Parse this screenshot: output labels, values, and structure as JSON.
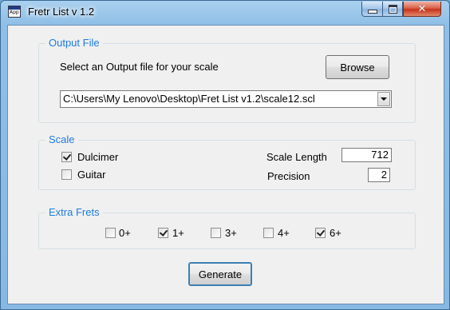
{
  "window": {
    "title": "Fretr List v 1.2",
    "app_icon_text": "App"
  },
  "output_file": {
    "legend": "Output File",
    "prompt": "Select an Output file for your scale",
    "browse_label": "Browse",
    "path_value": "C:\\Users\\My Lenovo\\Desktop\\Fret List v1.2\\scale12.scl"
  },
  "scale": {
    "legend": "Scale",
    "options": [
      {
        "label": "Dulcimer",
        "checked": true
      },
      {
        "label": "Guitar",
        "checked": false
      }
    ],
    "length_label": "Scale Length",
    "length_value": "712",
    "precision_label": "Precision",
    "precision_value": "2"
  },
  "extra_frets": {
    "legend": "Extra Frets",
    "options": [
      {
        "label": "0+",
        "checked": false
      },
      {
        "label": "1+",
        "checked": true
      },
      {
        "label": "3+",
        "checked": false
      },
      {
        "label": "4+",
        "checked": false
      },
      {
        "label": "6+",
        "checked": true
      }
    ]
  },
  "generate_label": "Generate"
}
